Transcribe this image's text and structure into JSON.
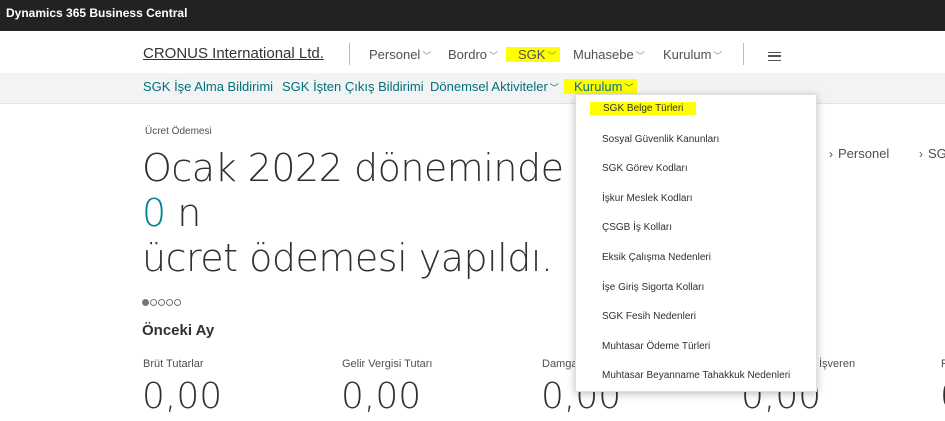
{
  "app": {
    "title": "Dynamics 365 Business Central"
  },
  "nav": {
    "company": "CRONUS International Ltd.",
    "items": [
      {
        "label": "Personel",
        "chevron": "chevron-down-icon"
      },
      {
        "label": "Bordro",
        "chevron": "chevron-down-icon"
      },
      {
        "label": "SGK",
        "chevron": "chevron-down-icon",
        "highlighted": true
      },
      {
        "label": "Muhasebe",
        "chevron": "chevron-down-icon"
      },
      {
        "label": "Kurulum",
        "chevron": "chevron-down-icon"
      }
    ],
    "menu_icon": "hamburger-icon"
  },
  "subnav": {
    "items": [
      {
        "label": "SGK İşe Alma Bildirimi"
      },
      {
        "label": "SGK İşten Çıkış Bildirimi"
      },
      {
        "label": "Dönemsel Aktiviteler",
        "chevron": "chevron-down-icon"
      },
      {
        "label": "Kurulum",
        "chevron": "chevron-down-icon",
        "highlighted": true
      }
    ]
  },
  "dropdown": {
    "items": [
      "SGK Belge Türleri",
      "Sosyal Güvenlik Kanunları",
      "SGK Görev Kodları",
      "İşkur Meslek Kodları",
      "ÇSGB İş Kolları",
      "Eksik Çalışma Nedenleri",
      "İşe Giriş Sigorta Kolları",
      "SGK Fesih Nedenleri",
      "Muhtasar Ödeme Türleri",
      "Muhtasar Beyanname Tahakkuk Nedenleri"
    ],
    "highlighted_index": 0
  },
  "main": {
    "caption": "Ücret Ödemesi",
    "headline": {
      "part1": "Ocak 2022 döneminde ",
      "number": "0",
      "part2": " n",
      "line2": "ücret ödemesi yapıldı."
    },
    "links": [
      "Personel",
      "SG"
    ],
    "carousel": {
      "count": 5,
      "active": 0
    },
    "section_title": "Önceki Ay",
    "tiles": [
      {
        "label": "Brüt Tutarlar",
        "value": "0,00"
      },
      {
        "label": "Gelir Vergisi Tutarı",
        "value": "0,00"
      },
      {
        "label": "Damga",
        "value": "0,00"
      },
      {
        "label": "İşveren",
        "value": "0,00"
      },
      {
        "label": "P",
        "value": "0"
      }
    ]
  },
  "colors": {
    "topbar": "#222222",
    "accent": "#00858f",
    "highlight": "#ffff00",
    "subnav_bg": "#f1f3f5"
  }
}
